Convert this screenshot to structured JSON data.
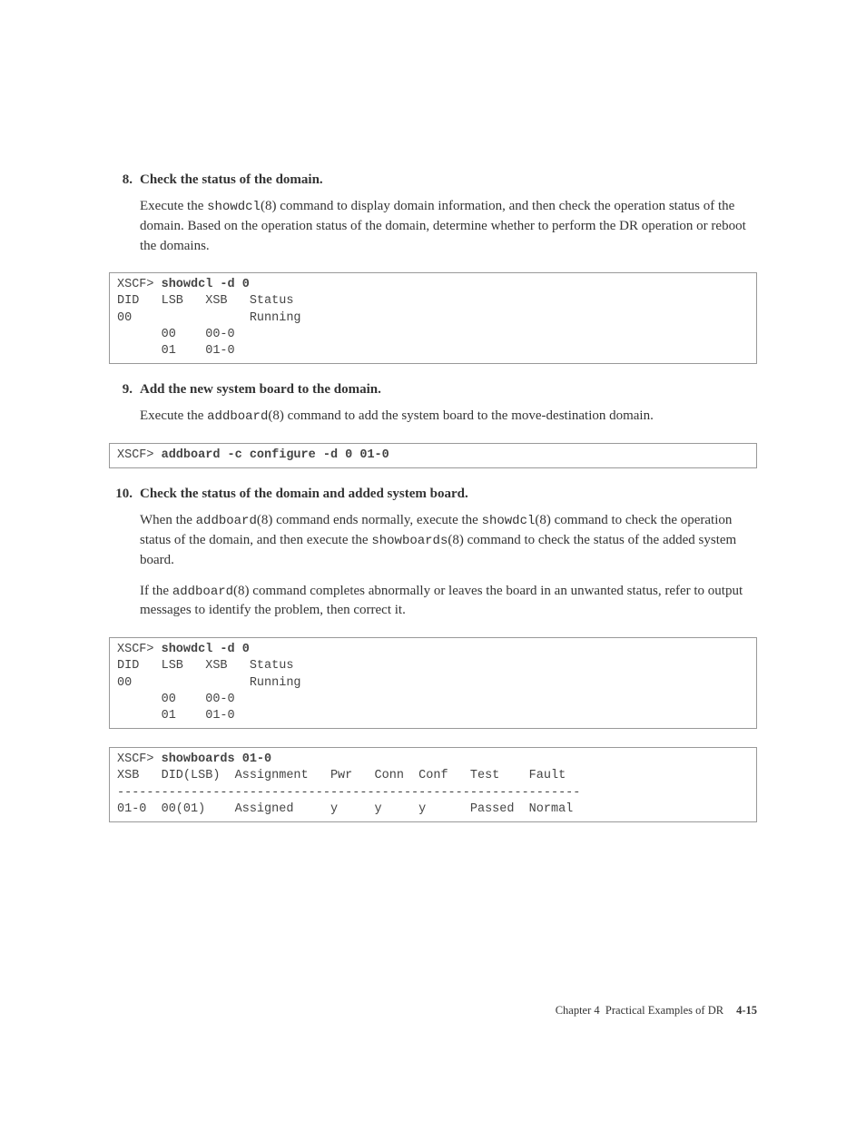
{
  "steps": [
    {
      "num": "8.",
      "title": "Check the status of the domain.",
      "paragraphs": [
        {
          "segments": [
            {
              "t": "Execute the "
            },
            {
              "t": "showdcl",
              "mono": true
            },
            {
              "t": "(8) command to display domain information, and then check the operation status of the domain. Based on the operation status of the domain, determine whether to perform the DR operation or reboot the domains."
            }
          ]
        }
      ]
    },
    {
      "num": "9.",
      "title": "Add the new system board to the domain.",
      "paragraphs": [
        {
          "segments": [
            {
              "t": "Execute the "
            },
            {
              "t": "addboard",
              "mono": true
            },
            {
              "t": "(8) command to add the system board to the move-destination domain."
            }
          ]
        }
      ]
    },
    {
      "num": "10.",
      "title": "Check the status of the domain and added system board.",
      "paragraphs": [
        {
          "segments": [
            {
              "t": "When the "
            },
            {
              "t": "addboard",
              "mono": true
            },
            {
              "t": "(8) command ends normally, execute the "
            },
            {
              "t": "showdcl",
              "mono": true
            },
            {
              "t": "(8) command to check the operation status of the domain, and then execute the "
            },
            {
              "t": "showboards",
              "mono": true
            },
            {
              "t": "(8) command to check the status of the added system board."
            }
          ]
        },
        {
          "segments": [
            {
              "t": "If the "
            },
            {
              "t": "addboard",
              "mono": true
            },
            {
              "t": "(8) command completes abnormally or leaves the board in an unwanted status, refer to output messages to identify the problem, then correct it."
            }
          ]
        }
      ]
    }
  ],
  "codeblocks": {
    "block1": {
      "prompt": "XSCF> ",
      "cmd": "showdcl -d 0",
      "lines": [
        "DID   LSB   XSB   Status",
        "00                Running",
        "      00    00-0",
        "      01    01-0"
      ]
    },
    "block2": {
      "prompt": "XSCF> ",
      "cmd": "addboard -c configure -d 0 01-0",
      "lines": []
    },
    "block3": {
      "prompt": "XSCF> ",
      "cmd": "showdcl -d 0",
      "lines": [
        "DID   LSB   XSB   Status",
        "00                Running",
        "      00    00-0",
        "      01    01-0"
      ]
    },
    "block4": {
      "prompt": "XSCF> ",
      "cmd": "showboards 01-0",
      "lines": [
        "XSB   DID(LSB)  Assignment   Pwr   Conn  Conf   Test    Fault",
        "---------------------------------------------------------------",
        "01-0  00(01)    Assigned     y     y     y      Passed  Normal"
      ]
    }
  },
  "footer": {
    "chapter": "Chapter 4",
    "title": "Practical Examples of DR",
    "page": "4-15"
  }
}
